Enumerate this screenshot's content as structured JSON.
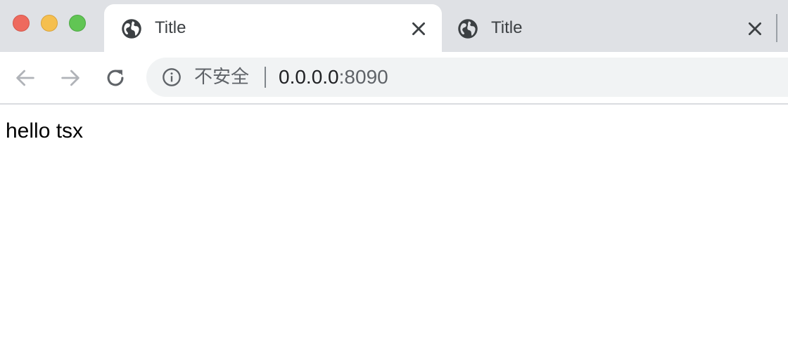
{
  "window": {
    "controls": [
      "close",
      "minimize",
      "maximize"
    ]
  },
  "tabs": [
    {
      "label": "Title",
      "icon": "globe-icon",
      "active": true
    },
    {
      "label": "Title",
      "icon": "globe-icon",
      "active": false
    }
  ],
  "toolbar": {
    "back_icon": "arrow-left-icon",
    "forward_icon": "arrow-right-icon",
    "reload_icon": "reload-icon"
  },
  "omnibox": {
    "security_icon": "info-icon",
    "security_label": "不安全",
    "url_host": "0.0.0.0",
    "url_port": ":8090"
  },
  "page": {
    "body_text": "hello tsx"
  },
  "colors": {
    "tabstrip_bg": "#dfe1e5",
    "omnibox_bg": "#f1f3f4",
    "traffic_close": "#ee6a5e",
    "traffic_minimize": "#f5bf4f",
    "traffic_maximize": "#61c554"
  }
}
